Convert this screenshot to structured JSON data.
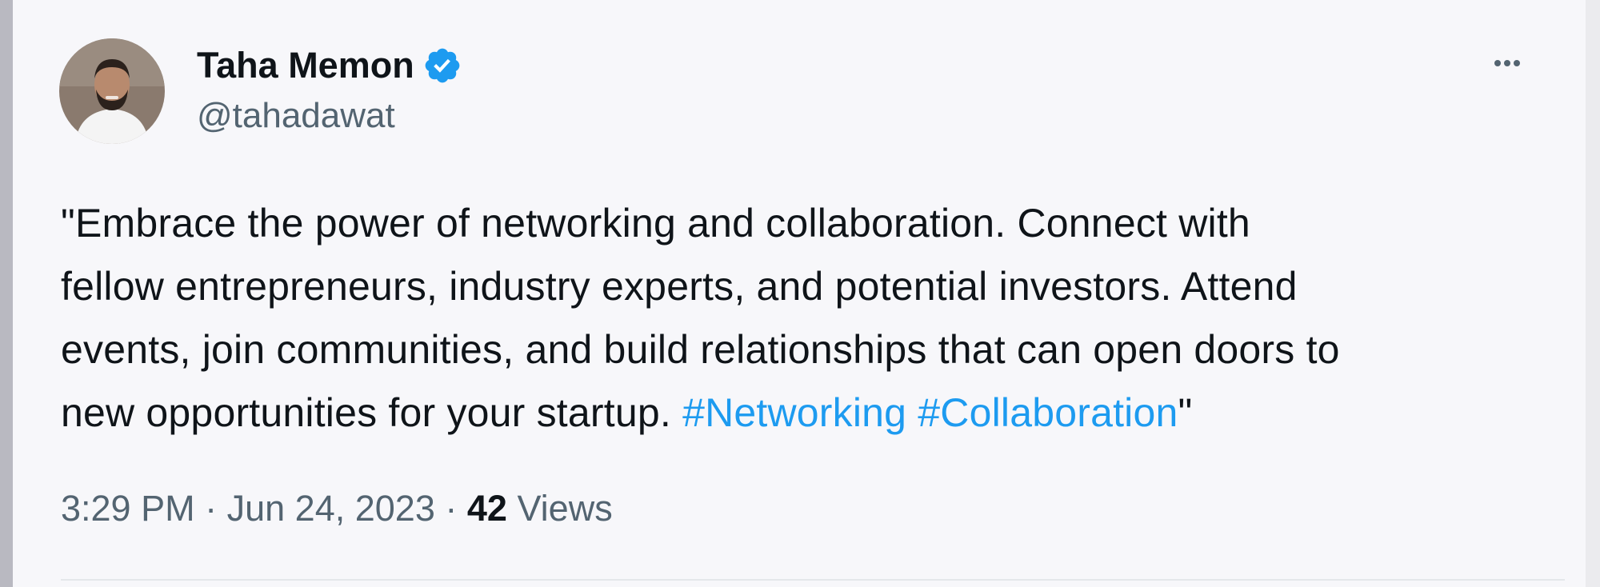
{
  "tweet": {
    "author": {
      "display_name": "Taha Memon",
      "handle": "@tahadawat",
      "verified": true,
      "avatar_icon": "profile-photo"
    },
    "text_lines": {
      "line1": "\"Embrace the power of networking and collaboration. Connect with",
      "line2": "fellow entrepreneurs, industry experts, and potential investors. Attend",
      "line3": "events, join communities, and build relationships that can open doors to",
      "line4_prefix": "new opportunities for your startup. ",
      "hashtag1": "#Networking",
      "hashtag2": "#Collaboration",
      "line4_suffix": "\""
    },
    "time": "3:29 PM",
    "date": "Jun 24, 2023",
    "separator": "·",
    "views_count": "42",
    "views_label": "Views",
    "more_icon": "more-options-icon"
  },
  "colors": {
    "accent": "#1d9bf0",
    "text": "#0f1419",
    "secondary": "#536471",
    "background": "#f7f7fa"
  }
}
